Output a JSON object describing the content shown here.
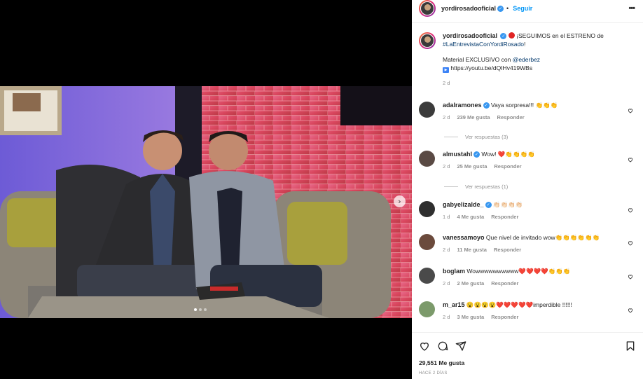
{
  "post": {
    "author": "yordirosadooficial",
    "follow_label": "Seguir",
    "more_label": "•••",
    "caption": {
      "username": "yordirosadooficial",
      "text_1": "¡SEGUIMOS en el ESTRENO de",
      "hashtag": "#LaEntrevistaConYordiRosado",
      "text_2": "!",
      "text_3": "Material EXCLUSIVO con",
      "mention": "@ederbez",
      "link": "https://youtu.be/dQIHv419WBs",
      "time": "2 d"
    },
    "likes": "29,551 Me gusta",
    "posted_ago": "HACE 2 DÍAS"
  },
  "comments": [
    {
      "username": "adalramones",
      "verified": true,
      "text": "Vaya sorpresa!!! 👏👏👏",
      "time": "2 d",
      "likes": "239 Me gusta",
      "reply_label": "Responder",
      "view_replies": "Ver respuestas (3)",
      "avatar_color": "#3b3b3b"
    },
    {
      "username": "almustahl",
      "verified": true,
      "text": "Wow! ❤️👏👏👏👏",
      "time": "2 d",
      "likes": "25 Me gusta",
      "reply_label": "Responder",
      "view_replies": "Ver respuestas (1)",
      "avatar_color": "#5a4a44"
    },
    {
      "username": "gabyelizalde_",
      "verified": true,
      "text": "👏🏻👏🏻👏🏻👏🏻",
      "time": "1 d",
      "likes": "4 Me gusta",
      "reply_label": "Responder",
      "avatar_color": "#2f2f2f"
    },
    {
      "username": "vanessamoyo",
      "verified": false,
      "text": "Que nivel de invitado wow👏👏👏👏👏👏",
      "time": "2 d",
      "likes": "11 Me gusta",
      "reply_label": "Responder",
      "avatar_color": "#6b4a3c"
    },
    {
      "username": "boglam",
      "verified": false,
      "text": "Wowwwwwwwwww❤️❤️❤️❤️👏👏👏",
      "time": "2 d",
      "likes": "2 Me gusta",
      "reply_label": "Responder",
      "avatar_color": "#4a4a4a"
    },
    {
      "username": "m_ar15",
      "verified": false,
      "text": "😮😮😮😮❤️❤️❤️❤️❤️imperdible !!!!!!",
      "time": "2 d",
      "likes": "3 Me gusta",
      "reply_label": "Responder",
      "avatar_color": "#7c9a6b"
    }
  ],
  "colors": {
    "accent": "#0095f6",
    "verified": "#3897f0",
    "link": "#00376b",
    "secondary_text": "#8e8e8e"
  },
  "icons": [
    "heart-icon",
    "comment-icon",
    "share-icon",
    "bookmark-icon",
    "chevron-right-icon",
    "more-icon",
    "verified-icon"
  ]
}
